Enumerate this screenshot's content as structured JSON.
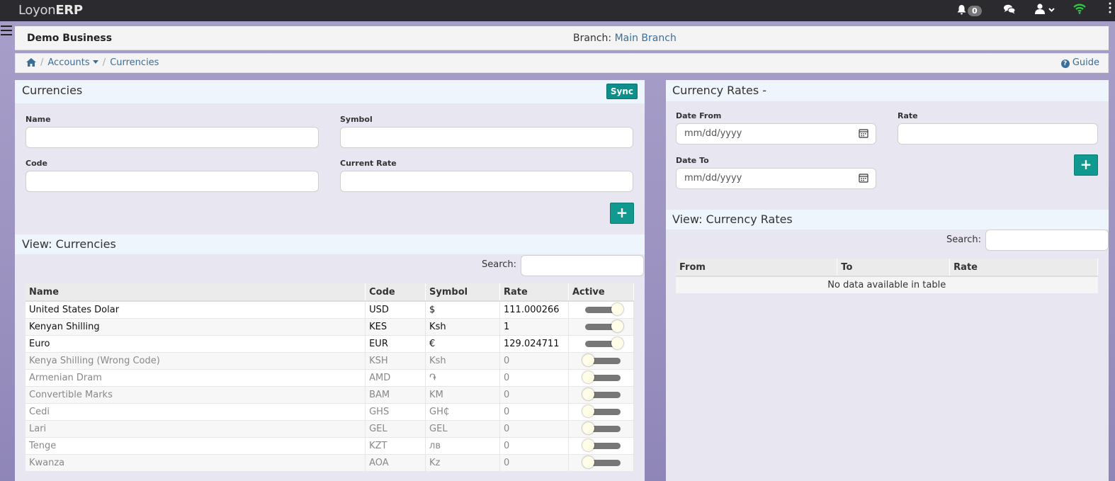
{
  "app": {
    "brand_light": "Loyon",
    "brand_bold": "ERP",
    "notifications_count": "0"
  },
  "business": {
    "name": "Demo Business",
    "branch_label": "Branch:",
    "branch_value": "Main Branch"
  },
  "breadcrumb": {
    "accounts": "Accounts",
    "current": "Currencies",
    "guide": "Guide"
  },
  "currencies_form": {
    "title": "Currencies",
    "sync_label": "Sync",
    "name_label": "Name",
    "symbol_label": "Symbol",
    "code_label": "Code",
    "current_rate_label": "Current Rate",
    "add_label": "+"
  },
  "currencies_view": {
    "title": "View: Currencies",
    "search_label": "Search:",
    "columns": [
      "Name",
      "Code",
      "Symbol",
      "Rate",
      "Active"
    ],
    "rows": [
      {
        "name": "United States Dolar",
        "code": "USD",
        "symbol": "$",
        "rate": "111.000266",
        "active": true
      },
      {
        "name": "Kenyan Shilling",
        "code": "KES",
        "symbol": "Ksh",
        "rate": "1",
        "active": true
      },
      {
        "name": "Euro",
        "code": "EUR",
        "symbol": "€",
        "rate": "129.024711",
        "active": true
      },
      {
        "name": "Kenya Shilling (Wrong Code)",
        "code": "KSH",
        "symbol": "Ksh",
        "rate": "0",
        "active": false
      },
      {
        "name": "Armenian Dram",
        "code": "AMD",
        "symbol": "֏",
        "rate": "0",
        "active": false
      },
      {
        "name": "Convertible Marks",
        "code": "BAM",
        "symbol": "KM",
        "rate": "0",
        "active": false
      },
      {
        "name": "Cedi",
        "code": "GHS",
        "symbol": "GH₵",
        "rate": "0",
        "active": false
      },
      {
        "name": "Lari",
        "code": "GEL",
        "symbol": "GEL",
        "rate": "0",
        "active": false
      },
      {
        "name": "Tenge",
        "code": "KZT",
        "symbol": "лв",
        "rate": "0",
        "active": false
      },
      {
        "name": "Kwanza",
        "code": "AOA",
        "symbol": "Kz",
        "rate": "0",
        "active": false
      }
    ]
  },
  "rates_form": {
    "title": "Currency Rates -",
    "date_from_label": "Date From",
    "date_from_placeholder": "mm/dd/yyyy",
    "date_to_label": "Date To",
    "date_to_placeholder": "mm/dd/yyyy",
    "rate_label": "Rate",
    "add_label": "+"
  },
  "rates_view": {
    "title": "View: Currency Rates",
    "search_label": "Search:",
    "columns": [
      "From",
      "To",
      "Rate"
    ],
    "empty_message": "No data available in table"
  },
  "colors": {
    "accent_teal": "#12998f",
    "link_blue": "#3a6e9a",
    "topbar": "#2b2b2f"
  }
}
